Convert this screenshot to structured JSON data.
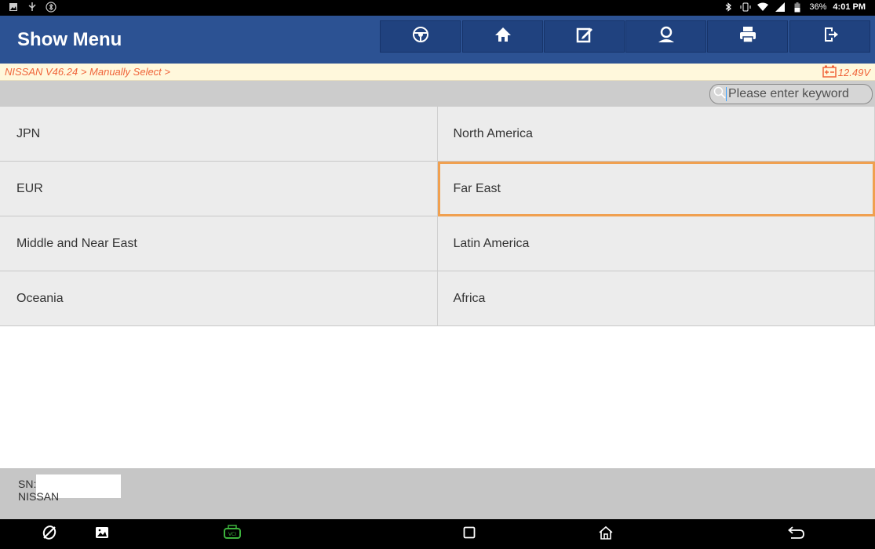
{
  "status_bar": {
    "battery": "36%",
    "time": "4:01 PM"
  },
  "header": {
    "title": "Show Menu",
    "buttons": [
      {
        "icon": "steering-wheel-icon"
      },
      {
        "icon": "home-icon"
      },
      {
        "icon": "edit-report-icon"
      },
      {
        "icon": "user-profile-icon"
      },
      {
        "icon": "print-icon"
      },
      {
        "icon": "exit-icon"
      }
    ]
  },
  "breadcrumb": {
    "path": "NISSAN V46.24 > Manually Select >",
    "voltage": "12.49V"
  },
  "search": {
    "placeholder": "Please enter keyword"
  },
  "menu": {
    "items": [
      "JPN",
      "North America",
      "EUR",
      "Far East",
      "Middle and Near East",
      "Latin America",
      "Oceania",
      "Africa"
    ],
    "selected": "Far East"
  },
  "footer": {
    "sn_label": "SN:",
    "brand": "NISSAN"
  },
  "colors": {
    "header_bg": "#2c5293",
    "accent_orange": "#f0643a",
    "selection_border": "#f0a050",
    "vci_green": "#3db33d"
  }
}
